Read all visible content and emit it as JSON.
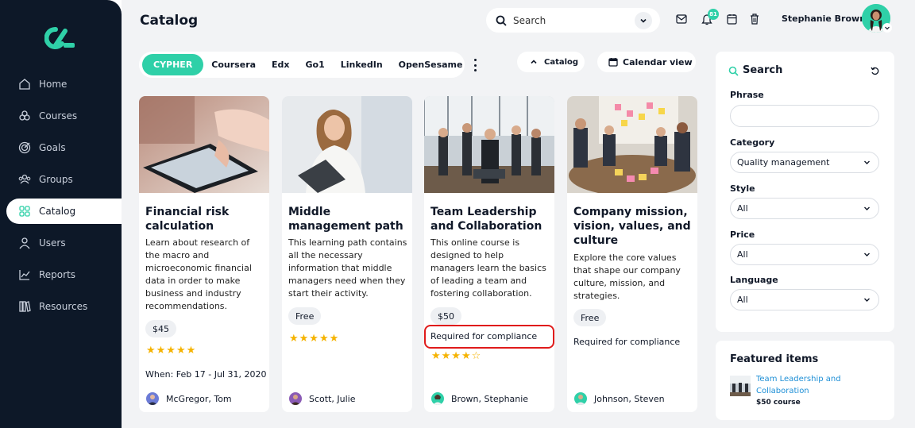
{
  "sidebar": {
    "items": [
      {
        "label": "Home",
        "icon": "home-icon"
      },
      {
        "label": "Courses",
        "icon": "courses-icon"
      },
      {
        "label": "Goals",
        "icon": "goals-icon"
      },
      {
        "label": "Groups",
        "icon": "groups-icon"
      },
      {
        "label": "Catalog",
        "icon": "catalog-icon",
        "active": true
      },
      {
        "label": "Users",
        "icon": "user-icon"
      },
      {
        "label": "Reports",
        "icon": "reports-icon"
      },
      {
        "label": "Resources",
        "icon": "resources-icon"
      }
    ]
  },
  "header": {
    "title": "Catalog",
    "search_placeholder": "Search",
    "notification_count": "81",
    "user_name": "Stephanie Brown"
  },
  "tabs": [
    "CYPHER",
    "Coursera",
    "Edx",
    "Go1",
    "LinkedIn",
    "OpenSesame"
  ],
  "toolbar": {
    "catalog_label": "Catalog",
    "calendar_label": "Calendar view"
  },
  "cards": [
    {
      "title": "Financial risk calculation",
      "description": "Learn about research of the macro and microeconomic financial data in order to make business and industry recommendations.",
      "price": "$45",
      "rating": 5,
      "stars": "★★★★★",
      "when": "When: Feb 17 - Jul 31, 2020",
      "author": "McGregor, Tom"
    },
    {
      "title": "Middle management path",
      "description": "This learning path contains all the necessary information that middle managers need when they start their activity.",
      "price": "Free",
      "rating": 5,
      "stars": "★★★★★",
      "author": "Scott, Julie"
    },
    {
      "title": "Team Leadership and Collaboration",
      "description": "This online course is designed to help managers learn the basics of leading a team and fostering collaboration.",
      "price": "$50",
      "requirement": "Required for compliance",
      "rating": 4.5,
      "stars": "★★★★☆",
      "author": "Brown, Stephanie"
    },
    {
      "title": "Company mission, vision, values, and culture",
      "description": "Explore the core values that shape our company culture, mission, and strategies.",
      "price": "Free",
      "requirement": "Required for compliance",
      "author": "Johnson, Steven"
    }
  ],
  "filters": {
    "title": "Search",
    "phrase_label": "Phrase",
    "phrase_value": "",
    "category_label": "Category",
    "category_value": "Quality management",
    "style_label": "Style",
    "style_value": "All",
    "price_label": "Price",
    "price_value": "All",
    "language_label": "Language",
    "language_value": "All"
  },
  "featured": {
    "title": "Featured items",
    "item_title": "Team Leadership and Collaboration",
    "item_price": "$50 course"
  },
  "colors": {
    "accent": "#2fd0a8",
    "sidebar_bg": "#0d1828",
    "highlight_border": "#e01b1b",
    "star": "#f5b301",
    "link": "#1e8fd6"
  }
}
